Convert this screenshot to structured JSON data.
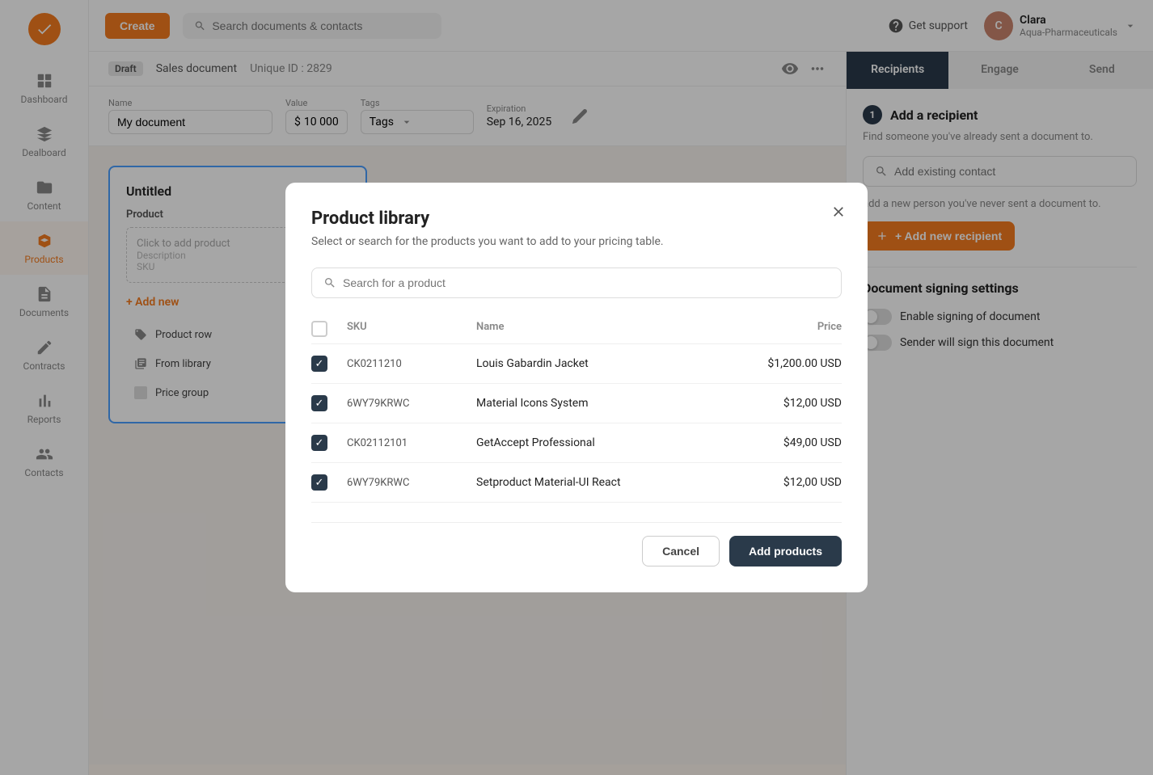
{
  "app": {
    "logo_alt": "GetAccept logo"
  },
  "topbar": {
    "create_label": "Create",
    "search_placeholder": "Search documents & contacts",
    "support_label": "Get support",
    "user": {
      "name": "Clara",
      "company": "Aqua-Pharmaceuticals",
      "initials": "C"
    }
  },
  "sidebar": {
    "items": [
      {
        "id": "dashboard",
        "label": "Dashboard",
        "icon": "grid"
      },
      {
        "id": "dealboard",
        "label": "Dealboard",
        "icon": "layers"
      },
      {
        "id": "content",
        "label": "Content",
        "icon": "folder"
      },
      {
        "id": "products",
        "label": "Products",
        "icon": "box",
        "active": true
      },
      {
        "id": "documents",
        "label": "Documents",
        "icon": "file"
      },
      {
        "id": "contracts",
        "label": "Contracts",
        "icon": "edit"
      },
      {
        "id": "reports",
        "label": "Reports",
        "icon": "bar-chart"
      },
      {
        "id": "contacts",
        "label": "Contacts",
        "icon": "users"
      }
    ]
  },
  "document": {
    "status": "Draft",
    "type": "Sales document",
    "unique_id_label": "Unique ID : 2829",
    "name_label": "Name",
    "name_value": "My document",
    "value_label": "Value",
    "value_prefix": "$",
    "value": "10 000",
    "tags_label": "Tags",
    "expiration_label": "Expiration",
    "expiration_date": "Sep 16, 2025",
    "card_title": "Untitled",
    "card_section": "Product",
    "click_to_add": "Click to add product",
    "description": "Description",
    "sku": "SKU",
    "add_new_label": "+ Add new",
    "menu_items": [
      {
        "id": "product-row",
        "label": "Product row",
        "icon": "tag"
      },
      {
        "id": "from-library",
        "label": "From library",
        "icon": "library"
      },
      {
        "id": "price-group",
        "label": "Price group",
        "icon": "grid-small"
      }
    ]
  },
  "right_panel": {
    "tabs": [
      {
        "id": "recipients",
        "label": "Recipients",
        "active": true
      },
      {
        "id": "engage",
        "label": "Engage",
        "active": false
      },
      {
        "id": "send",
        "label": "Send",
        "active": false
      }
    ],
    "add_recipient": {
      "step": "1",
      "title": "Add a recipient",
      "subtitle": "Find someone you've already sent a document to.",
      "search_placeholder": "Add existing contact",
      "new_person_text": "add a new person you've never sent a document to.",
      "add_new_label": "+ Add new recipient"
    },
    "signing_settings": {
      "title": "Document signing settings",
      "toggles": [
        {
          "id": "enable-signing",
          "label": "Enable signing of document"
        },
        {
          "id": "sender-sign",
          "label": "Sender will sign this document"
        }
      ]
    }
  },
  "modal": {
    "title": "Product library",
    "subtitle": "Select or search for the products you want to add to your pricing table.",
    "search_placeholder": "Search for a product",
    "columns": {
      "sku": "SKU",
      "name": "Name",
      "price": "Price"
    },
    "products": [
      {
        "id": 1,
        "sku": "CK0211210",
        "name": "Louis Gabardin Jacket",
        "price": "$1,200.00 USD",
        "checked": true
      },
      {
        "id": 2,
        "sku": "6WY79KRWC",
        "name": "Material Icons System",
        "price": "$12,00 USD",
        "checked": true
      },
      {
        "id": 3,
        "sku": "CK02112101",
        "name": "GetAccept Professional",
        "price": "$49,00 USD",
        "checked": true
      },
      {
        "id": 4,
        "sku": "6WY79KRWC",
        "name": "Setproduct Material-UI React",
        "price": "$12,00 USD",
        "checked": true
      }
    ],
    "cancel_label": "Cancel",
    "add_products_label": "Add products"
  }
}
